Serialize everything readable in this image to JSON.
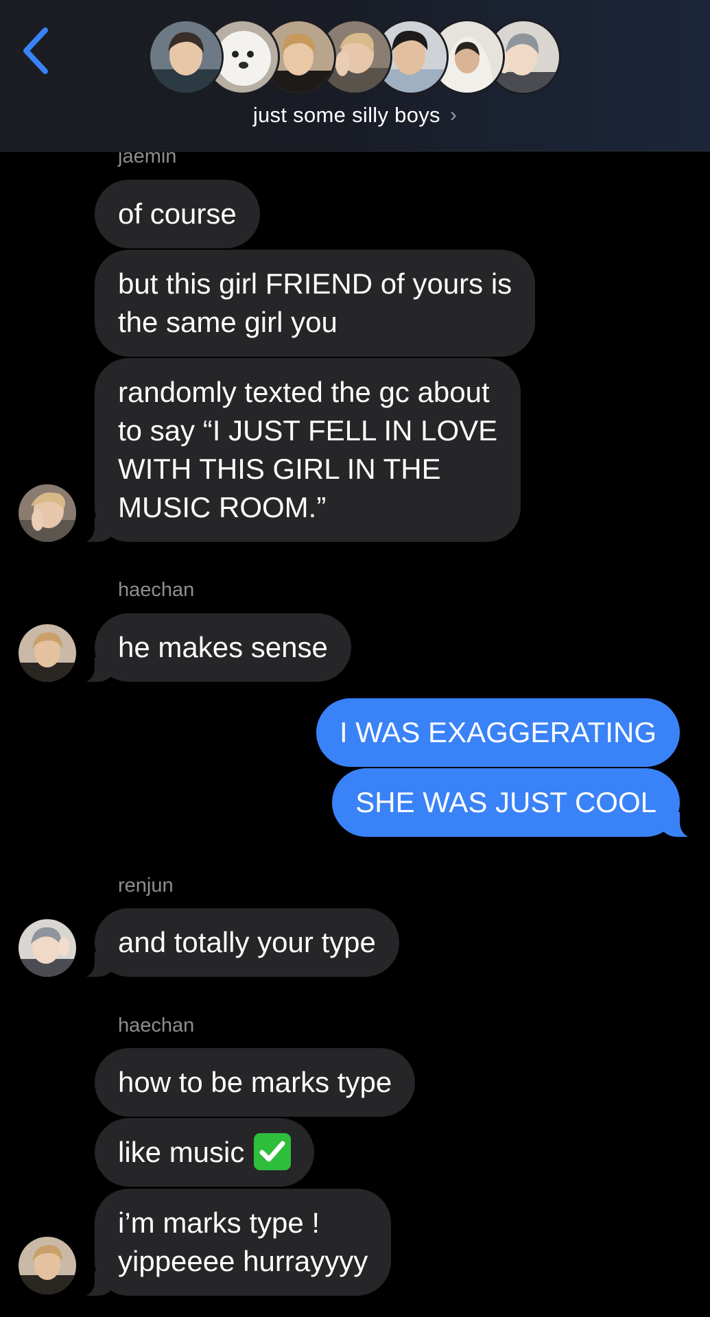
{
  "header": {
    "group_name": "just some silly boys",
    "back_icon": "chevron-left-icon",
    "chevron_icon": "chevron-right-icon",
    "accent_color": "#3a82f7"
  },
  "messages": [
    {
      "type": "sender",
      "name": "jaemin"
    },
    {
      "type": "in",
      "lines": [
        "of course"
      ]
    },
    {
      "type": "in",
      "lines": [
        "but this girl FRIEND of yours is",
        "the same girl you"
      ]
    },
    {
      "type": "in",
      "lines": [
        "randomly texted the gc about",
        "to say “I JUST FELL IN LOVE",
        "WITH THIS GIRL IN THE",
        "MUSIC ROOM.”"
      ]
    },
    {
      "type": "sender",
      "name": "haechan"
    },
    {
      "type": "in",
      "lines": [
        "he makes sense"
      ]
    },
    {
      "type": "out",
      "lines": [
        "I WAS EXAGGERATING"
      ]
    },
    {
      "type": "out",
      "lines": [
        "SHE WAS JUST COOL"
      ]
    },
    {
      "type": "sender",
      "name": "renjun"
    },
    {
      "type": "in",
      "lines": [
        "and totally your type"
      ]
    },
    {
      "type": "sender",
      "name": "haechan"
    },
    {
      "type": "in",
      "lines": [
        "how to be marks type"
      ]
    },
    {
      "type": "in",
      "lines": [
        "like music"
      ],
      "emoji": "check-mark-button-emoji"
    },
    {
      "type": "in",
      "lines": [
        "i’m marks type !",
        "yippeeee hurrayyyy"
      ]
    }
  ],
  "colors": {
    "incoming_bubble": "#262629",
    "outgoing_bubble": "#3a82f7",
    "sender_label": "#8e8e93",
    "background": "#000000"
  }
}
